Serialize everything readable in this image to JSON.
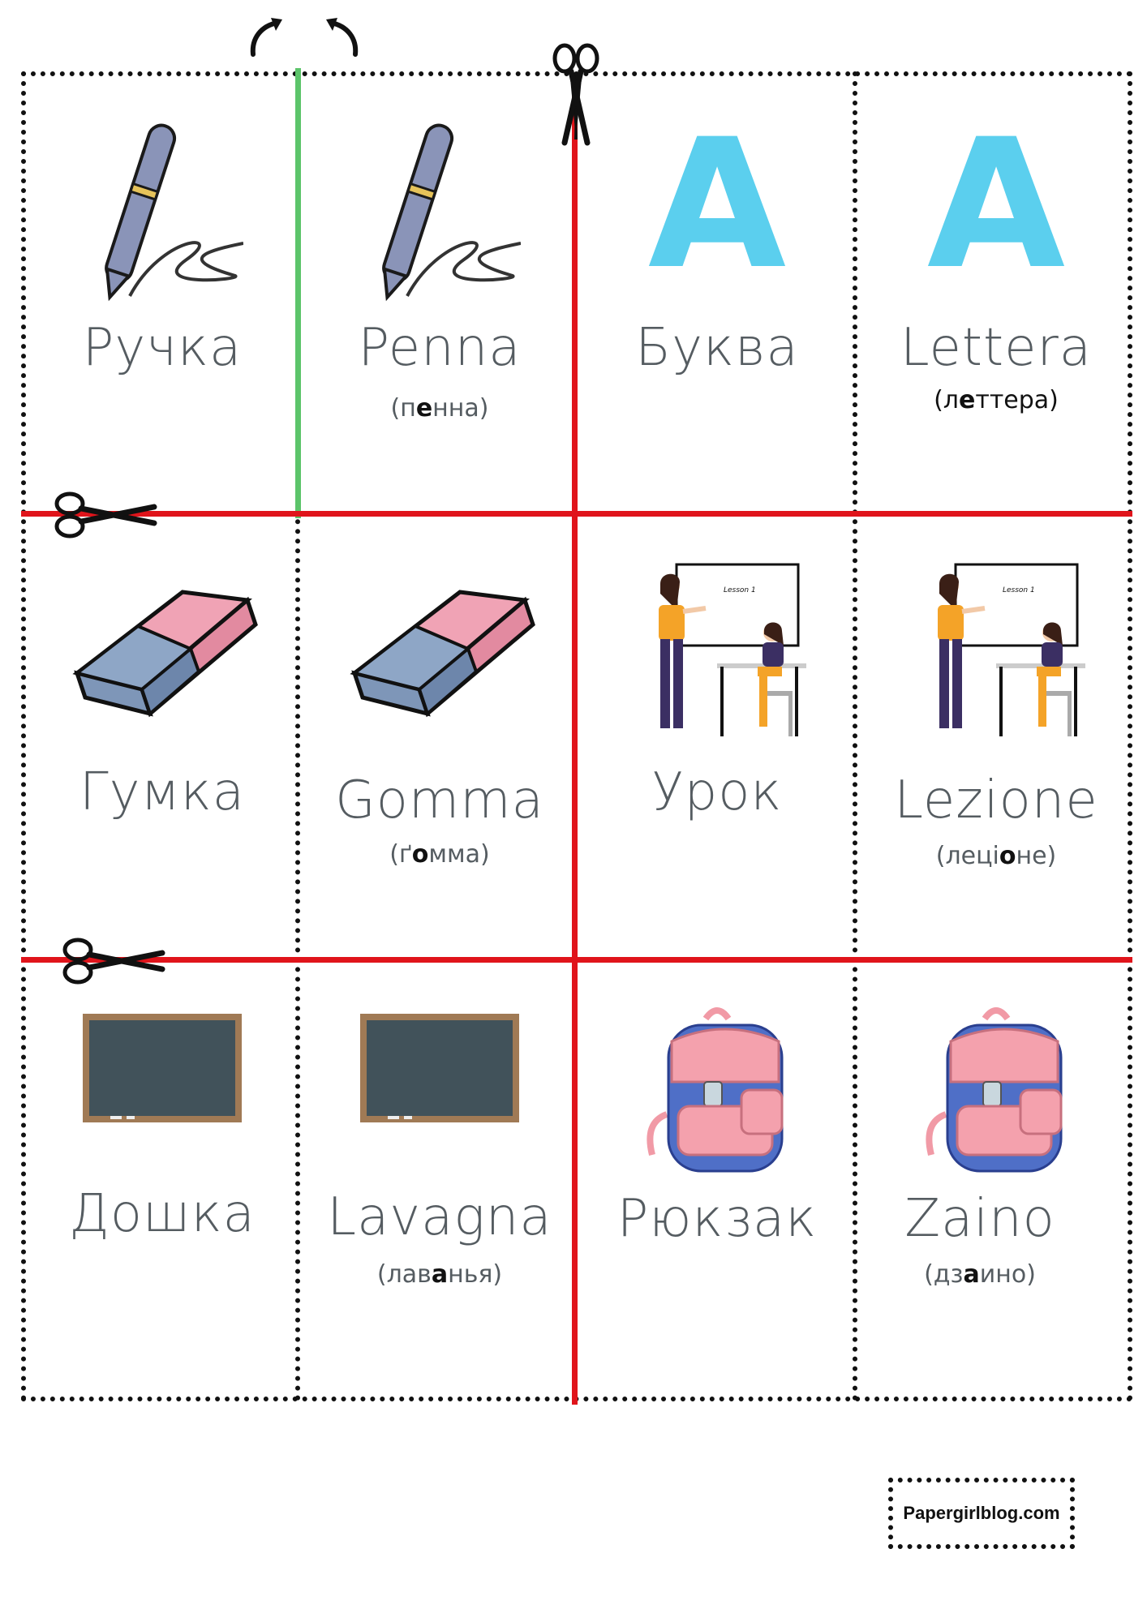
{
  "cards": [
    {
      "word": "Ручка",
      "icon": "pen-icon"
    },
    {
      "word": "Penna",
      "pron_pre": "(п",
      "pron_bold": "е",
      "pron_post": "нна)",
      "icon": "pen-icon"
    },
    {
      "word": "Буква",
      "icon": "letter-a-icon"
    },
    {
      "word": "Lettera",
      "pron_pre": "(л",
      "pron_bold": "е",
      "pron_post": "ттера)",
      "icon": "letter-a-icon"
    },
    {
      "word": "Гумка",
      "icon": "eraser-icon"
    },
    {
      "word": "Gomma",
      "pron_pre": "(ґ",
      "pron_bold": "о",
      "pron_post": "мма)",
      "icon": "eraser-icon"
    },
    {
      "word": "Урок",
      "icon": "lesson-icon"
    },
    {
      "word": "Lezione",
      "pron_pre": "(леці",
      "pron_bold": "о",
      "pron_post": "не)",
      "icon": "lesson-icon"
    },
    {
      "word": "Дошка",
      "icon": "blackboard-icon"
    },
    {
      "word": "Lavagna",
      "pron_pre": "(лав",
      "pron_bold": "а",
      "pron_post": "нья)",
      "icon": "blackboard-icon"
    },
    {
      "word": "Рюкзак",
      "icon": "backpack-icon"
    },
    {
      "word": "Zaino",
      "pron_pre": "(дз",
      "pron_bold": "а",
      "pron_post": "ино)",
      "icon": "backpack-icon"
    }
  ],
  "lesson_board_text": "Lesson 1",
  "letter_a": "A",
  "logo_text": "Papergirlblog.com",
  "colors": {
    "cut_line": "#e0141b",
    "fold_line": "#5cc46a",
    "letter": "#5bcfee"
  }
}
